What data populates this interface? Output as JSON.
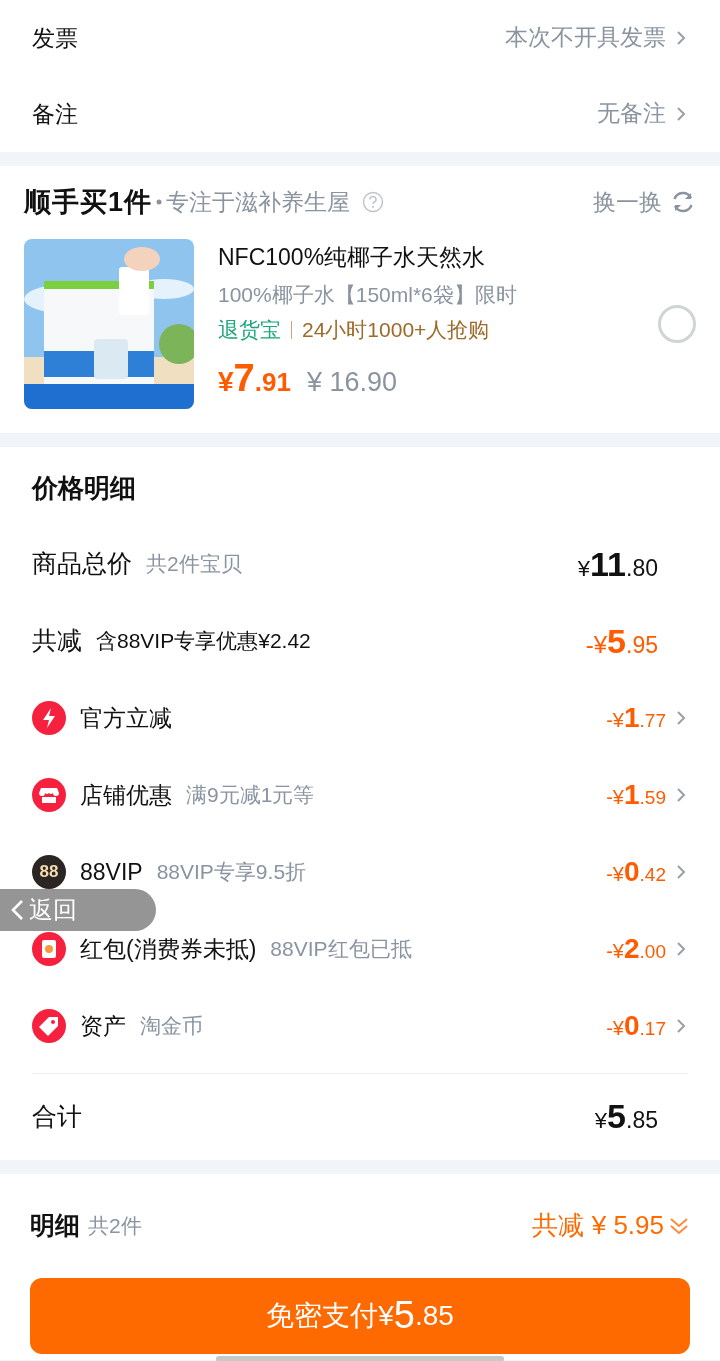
{
  "invoice_rows": [
    {
      "label": "发票",
      "value": "本次不开具发票"
    },
    {
      "label": "备注",
      "value": "无备注"
    }
  ],
  "add_on": {
    "title": "顺手买1件",
    "subtitle": "专注于滋补养生屋",
    "swap": "换一换",
    "product": {
      "kind": "picture",
      "name": "NFC100%纯椰子水天然水",
      "spec": "100%椰子水【150ml*6袋】限时",
      "badge": "退货宝",
      "promo": "24小时1000+人抢购",
      "price": "¥7.91",
      "original_price": "¥ 16.90",
      "selected": false
    }
  },
  "price_detail": {
    "title": "价格明细",
    "total": {
      "label": "商品总价",
      "note": "共2件宝贝",
      "amount": "¥11.80"
    },
    "discount": {
      "label": "共减",
      "note": "含88VIP专享优惠¥2.42",
      "amount": "-¥5.95"
    },
    "items": [
      {
        "kind": "bolt",
        "label": "官方立减",
        "amount": "-¥1.77"
      },
      {
        "kind": "shop",
        "label": "店铺优惠",
        "note": "满9元减1元等",
        "amount": "-¥1.59"
      },
      {
        "kind": "vip",
        "icon_text": "88",
        "label": "88VIP",
        "note": "88VIP专享9.5折",
        "amount": "-¥0.42"
      },
      {
        "kind": "redpacket",
        "label": "红包(消费券未抵)",
        "note": "88VIP红包已抵",
        "amount": "-¥2.00"
      },
      {
        "kind": "tag",
        "label": "资产",
        "note": "淘金币",
        "amount": "-¥0.17"
      }
    ],
    "sum": {
      "label": "合计",
      "amount": "¥5.85"
    }
  },
  "footer": {
    "label": "明细",
    "count": "共2件",
    "savings": "共减 ¥ 5.95",
    "pay_button": "免密支付¥5.85"
  },
  "back_overlay": {
    "label": "返回"
  }
}
